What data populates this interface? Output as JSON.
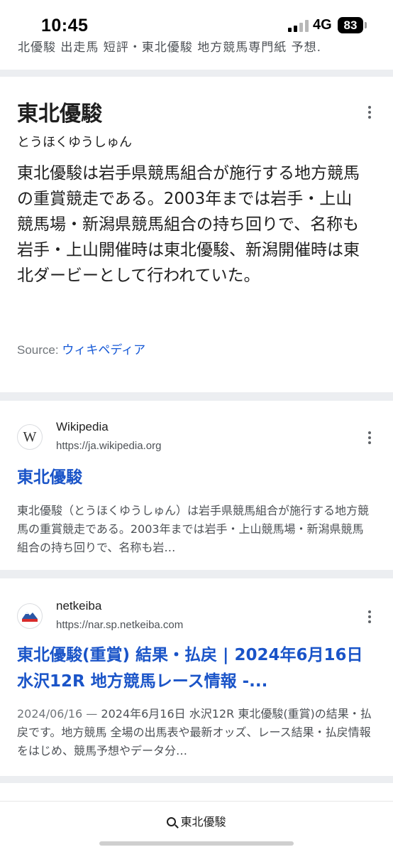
{
  "status_bar": {
    "time": "10:45",
    "network": "4G",
    "battery": "83"
  },
  "cut_off_text": "北優駿 出走馬 短評・東北優駿 地方競馬専門紙 予想.",
  "knowledge_panel": {
    "title": "東北優駿",
    "reading": "とうほくゆうしゅん",
    "description": "東北優駿は岩手県競馬組合が施行する地方競馬の重賞競走である。2003年までは岩手・上山競馬場・新潟県競馬組合の持ち回りで、名称も岩手・上山開催時は東北優駿、新潟開催時は東北ダービーとして行われていた。",
    "source_label": "Source:",
    "source_link": "ウィキペディア"
  },
  "results": [
    {
      "site_name": "Wikipedia",
      "url": "https://ja.wikipedia.org",
      "title": "東北優駿",
      "date": "",
      "snippet": "東北優駿（とうほくゆうしゅん）は岩手県競馬組合が施行する地方競馬の重賞競走である。2003年までは岩手・上山競馬場・新潟県競馬組合の持ち回りで、名称も岩…"
    },
    {
      "site_name": "netkeiba",
      "url": "https://nar.sp.netkeiba.com",
      "title": "東北優駿(重賞) 結果・払戻 | 2024年6月16日 水沢12R 地方競馬レース情報 -...",
      "date": "2024/06/16 —",
      "snippet": "2024年6月16日 水沢12R 東北優駿(重賞)の結果・払戻です。地方競馬 全場の出馬表や最新オッズ、レース結果・払戻情報をはじめ、競馬予想やデータ分…"
    }
  ],
  "bottom_bar": {
    "query": "東北優駿"
  },
  "colors": {
    "link": "#1a54c8",
    "snippet": "#4d5156",
    "divider": "#eceef1",
    "netkeiba_brand": "#2b57a6"
  },
  "icons": [
    "wikipedia-w-icon",
    "netkeiba-logo-icon",
    "more-vert-icon",
    "search-icon"
  ]
}
